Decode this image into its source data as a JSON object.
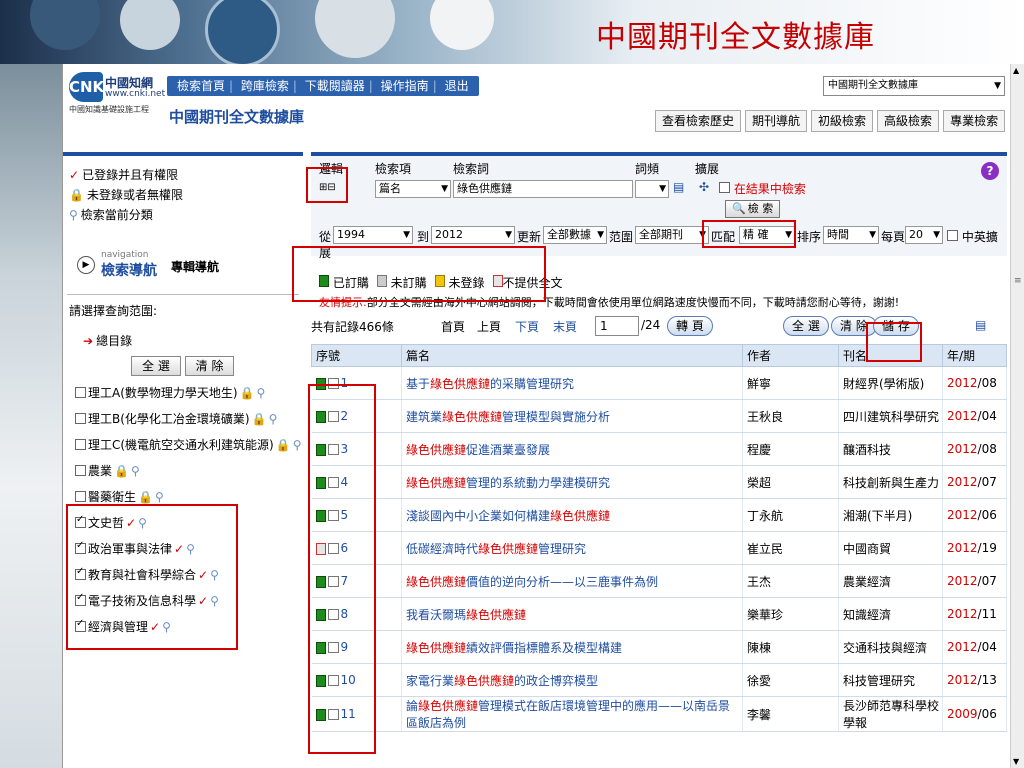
{
  "slide": {
    "title": "中國期刊全文數據庫"
  },
  "site": {
    "logo_mark": "CNKI",
    "logo_cn": "中國知網",
    "logo_url": "www.cnki.net",
    "tagline": "中國知識基礎設施工程",
    "db_name": "中國期刊全文數據庫",
    "nav": [
      "檢索首頁",
      "跨庫檢索",
      "下載閱讀器",
      "操作指南",
      "退出"
    ],
    "db_select": "中國期刊全文數據庫",
    "top_tabs": [
      "查看檢索歷史",
      "期刊導航",
      "初級檢索",
      "高級檢索",
      "專業檢索"
    ]
  },
  "sidebar": {
    "legend": [
      {
        "icon": "check-icon",
        "label": "已登錄并且有權限"
      },
      {
        "icon": "lock-icon",
        "label": "未登錄或者無權限"
      },
      {
        "icon": "magnifier-icon",
        "label": "檢索當前分類"
      }
    ],
    "nav_small": "navigation",
    "nav_big": "檢索導航",
    "nav_other": "專輯導航",
    "range_label": "請選擇查詢范圍:",
    "root": "總目錄",
    "select_all": "全 選",
    "clear": "清 除",
    "categories": [
      {
        "label": "理工A(數學物理力學天地生)",
        "checked": false,
        "access": "lock"
      },
      {
        "label": "理工B(化學化工冶金環境礦業)",
        "checked": false,
        "access": "lock"
      },
      {
        "label": "理工C(機電航空交通水利建筑能源)",
        "checked": false,
        "access": "lock"
      },
      {
        "label": "農業",
        "checked": false,
        "access": "lock"
      },
      {
        "label": "醫藥衛生",
        "checked": false,
        "access": "lock"
      },
      {
        "label": "文史哲",
        "checked": true,
        "access": "check"
      },
      {
        "label": "政治軍事與法律",
        "checked": true,
        "access": "check"
      },
      {
        "label": "教育與社會科學綜合",
        "checked": true,
        "access": "check"
      },
      {
        "label": "電子技術及信息科學",
        "checked": true,
        "access": "check"
      },
      {
        "label": "經濟與管理",
        "checked": true,
        "access": "check"
      }
    ]
  },
  "search": {
    "headers": {
      "logic": "邏輯",
      "field": "檢索項",
      "term": "檢索詞",
      "freq": "詞頻",
      "expand": "擴展"
    },
    "field_value": "篇名",
    "term_value": "綠色供應鏈",
    "in_results": "在結果中檢索",
    "search_btn": "檢 索",
    "from_label": "從",
    "from_year": "1994",
    "to_label": "到",
    "to_year": "2012",
    "update_label": "更新",
    "update_value": "全部數據",
    "scope_label": "范圍",
    "scope_value": "全部期刊",
    "match_label": "匹配",
    "match_value": "精 確",
    "sort_label": "排序",
    "sort_value": "時間",
    "perpage_label": "每頁",
    "perpage_value": "20",
    "cn_en": "中英擴",
    "cn_en_tail": "展",
    "help": "?"
  },
  "status_legend": [
    {
      "icon": "green",
      "label": "已訂購"
    },
    {
      "icon": "gray",
      "label": "未訂購"
    },
    {
      "icon": "yellow",
      "label": "未登錄"
    },
    {
      "icon": "red",
      "label": "不提供全文"
    }
  ],
  "tip": {
    "warn": "友情提示:",
    "text": "部分全文需經由海外中心網站調閱，下載時間會依使用單位網路速度快慢而不同，下載時請您耐心等待，謝謝!"
  },
  "results": {
    "count": "共有記錄466條",
    "first": "首頁",
    "prev": "上頁",
    "next": "下頁",
    "last": "末頁",
    "page": "1",
    "total_pages": "/24",
    "goto": "轉 頁",
    "select_all": "全 選",
    "clear": "清 除",
    "save": "儲 存",
    "columns": [
      "序號",
      "篇名",
      "作者",
      "刊名",
      "年/期"
    ],
    "rows": [
      {
        "no": "1",
        "pre": "基于",
        "hl": "綠色供應鏈",
        "post": "的采購管理研究",
        "author": "鮮寧",
        "journal": "財經界(學術版)",
        "year": "2012",
        "issue": "/08",
        "full": true
      },
      {
        "no": "2",
        "pre": "建筑業",
        "hl": "綠色供應鏈",
        "post": "管理模型與實施分析",
        "author": "王秋良",
        "journal": "四川建筑科學研究",
        "year": "2012",
        "issue": "/04",
        "full": true
      },
      {
        "no": "3",
        "pre": "",
        "hl": "綠色供應鏈",
        "post": "促進酒業臺發展",
        "author": "程慶",
        "journal": "釀酒科技",
        "year": "2012",
        "issue": "/08",
        "full": true
      },
      {
        "no": "4",
        "pre": "",
        "hl": "綠色供應鏈",
        "post": "管理的系統動力學建模研究",
        "author": "榮超",
        "journal": "科技創新與生產力",
        "year": "2012",
        "issue": "/07",
        "full": true
      },
      {
        "no": "5",
        "pre": "淺談國內中小企業如何構建",
        "hl": "綠色供應鏈",
        "post": "",
        "author": "丁永航",
        "journal": "湘潮(下半月)",
        "year": "2012",
        "issue": "/06",
        "full": true
      },
      {
        "no": "6",
        "pre": "低碳經濟時代",
        "hl": "綠色供應鏈",
        "post": "管理研究",
        "author": "崔立民",
        "journal": "中國商貿",
        "year": "2012",
        "issue": "/19",
        "full": false
      },
      {
        "no": "7",
        "pre": "",
        "hl": "綠色供應鏈",
        "post": "價值的逆向分析——以三鹿事件為例",
        "author": "王杰",
        "journal": "農業經濟",
        "year": "2012",
        "issue": "/07",
        "full": true
      },
      {
        "no": "8",
        "pre": "我看沃爾瑪",
        "hl": "綠色供應鏈",
        "post": "",
        "author": "樂華珍",
        "journal": "知識經濟",
        "year": "2012",
        "issue": "/11",
        "full": true
      },
      {
        "no": "9",
        "pre": "",
        "hl": "綠色供應鏈",
        "post": "績效評價指標體系及模型構建",
        "author": "陳棟",
        "journal": "交通科技與經濟",
        "year": "2012",
        "issue": "/04",
        "full": true
      },
      {
        "no": "10",
        "pre": "家電行業",
        "hl": "綠色供應鏈",
        "post": "的政企博弈模型",
        "author": "徐愛",
        "journal": "科技管理研究",
        "year": "2012",
        "issue": "/13",
        "full": true
      },
      {
        "no": "11",
        "pre": "論",
        "hl": "綠色供應鏈",
        "post": "管理模式在飯店環境管理中的應用——以南岳景區飯店為例",
        "author": "李馨",
        "journal": "長沙師范專科學校學報",
        "year": "2009",
        "issue": "/06",
        "full": true
      }
    ]
  }
}
